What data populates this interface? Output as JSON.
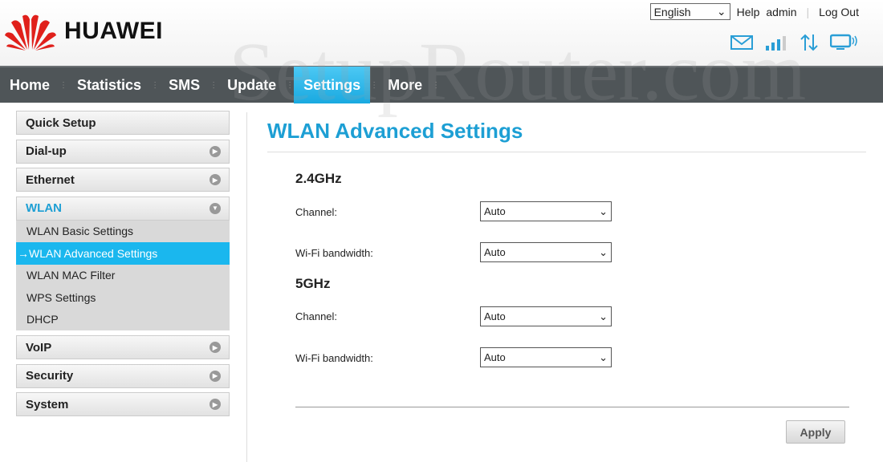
{
  "brand": {
    "name": "HUAWEI"
  },
  "top": {
    "language": "English",
    "help": "Help",
    "user": "admin",
    "logout": "Log Out"
  },
  "status_icons": [
    "mail-icon",
    "signal-icon",
    "data-transfer-icon",
    "device-connected-icon"
  ],
  "nav": [
    {
      "label": "Home"
    },
    {
      "label": "Statistics"
    },
    {
      "label": "SMS"
    },
    {
      "label": "Update"
    },
    {
      "label": "Settings",
      "active": true
    },
    {
      "label": "More"
    }
  ],
  "sidebar": {
    "items": [
      {
        "label": "Quick Setup"
      },
      {
        "label": "Dial-up"
      },
      {
        "label": "Ethernet"
      },
      {
        "label": "WLAN"
      },
      {
        "label": "VoIP"
      },
      {
        "label": "Security"
      },
      {
        "label": "System"
      }
    ],
    "wlan_sub": [
      {
        "label": "WLAN Basic Settings"
      },
      {
        "label": "WLAN Advanced Settings",
        "active": true
      },
      {
        "label": "WLAN MAC Filter"
      },
      {
        "label": "WPS Settings"
      },
      {
        "label": "DHCP"
      }
    ],
    "active_arrow": "→"
  },
  "main": {
    "title": "WLAN Advanced Settings",
    "band24": {
      "title": "2.4GHz",
      "channel_label": "Channel:",
      "channel": "Auto",
      "bw_label": "Wi-Fi bandwidth:",
      "bw": "Auto"
    },
    "band5": {
      "title": "5GHz",
      "channel_label": "Channel:",
      "channel": "Auto",
      "bw_label": "Wi-Fi bandwidth:",
      "bw": "Auto"
    },
    "apply": "Apply"
  },
  "watermark": "SetupRouter.com",
  "colors": {
    "accent": "#1d9fd4",
    "nav_bg": "#4f5558",
    "active": "#1ab7ee"
  }
}
